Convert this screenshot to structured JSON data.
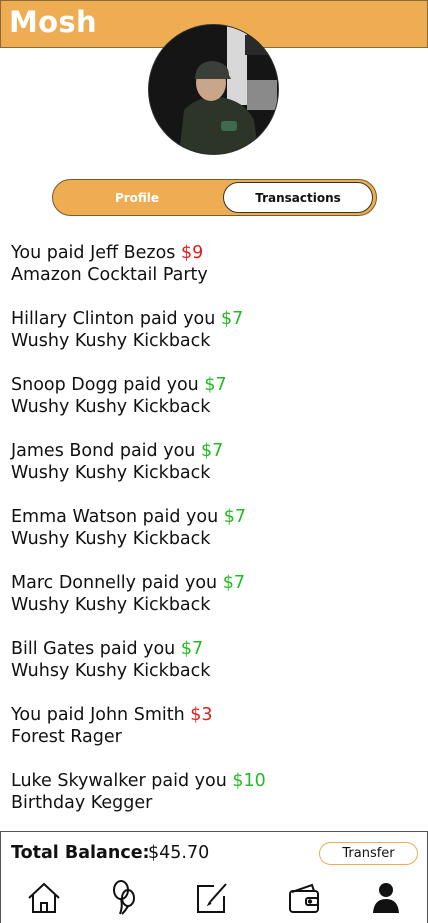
{
  "header": {
    "title": "Mosh"
  },
  "tabs_toggle": {
    "profile_label": "Profile",
    "transactions_label": "Transactions"
  },
  "transactions": [
    {
      "prefix": "You paid Jeff Bezos ",
      "amount": "$9",
      "direction": "out",
      "event": "Amazon Cocktail Party"
    },
    {
      "prefix": "Hillary Clinton paid you ",
      "amount": "$7",
      "direction": "in",
      "event": "Wushy Kushy Kickback"
    },
    {
      "prefix": "Snoop Dogg paid you ",
      "amount": "$7",
      "direction": "in",
      "event": "Wushy Kushy Kickback"
    },
    {
      "prefix": "James Bond paid you ",
      "amount": "$7",
      "direction": "in",
      "event": "Wushy Kushy Kickback"
    },
    {
      "prefix": "Emma Watson paid you ",
      "amount": "$7",
      "direction": "in",
      "event": "Wushy Kushy Kickback"
    },
    {
      "prefix": "Marc Donnelly paid you ",
      "amount": "$7",
      "direction": "in",
      "event": "Wushy Kushy Kickback"
    },
    {
      "prefix": "Bill Gates paid you ",
      "amount": "$7",
      "direction": "in",
      "event": "Wuhsy Kushy Kickback"
    },
    {
      "prefix": "You paid John Smith ",
      "amount": "$3",
      "direction": "out",
      "event": "Forest Rager"
    },
    {
      "prefix": "Luke Skywalker paid you ",
      "amount": "$10",
      "direction": "in",
      "event": "Birthday Kegger"
    }
  ],
  "balance": {
    "label": "Total Balance:",
    "value": "$45.70",
    "transfer_label": "Transfer"
  },
  "nav": {
    "icons": [
      "home-icon",
      "balloons-icon",
      "edit-icon",
      "wallet-icon",
      "user-icon"
    ]
  },
  "colors": {
    "accent": "#eead52",
    "negative": "#e02020",
    "positive": "#22bb22"
  }
}
